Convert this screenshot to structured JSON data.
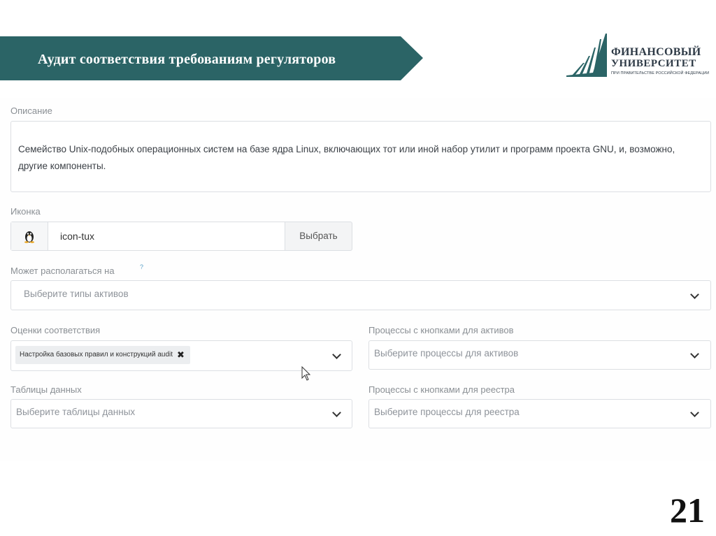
{
  "header": {
    "title": "Аудит соответствия требованиям регуляторов"
  },
  "logo": {
    "line1": "ФИНАНСОВЫЙ",
    "line2": "УНИВЕРСИТЕТ",
    "line3": "ПРИ ПРАВИТЕЛЬСТВЕ РОССИЙСКОЙ ФЕДЕРАЦИИ"
  },
  "form": {
    "description": {
      "label": "Описание",
      "value": "Семейство Unix-подобных операционных систем на базе ядра Linux, включающих тот или иной набор утилит и программ проекта GNU, и, возможно, другие компоненты."
    },
    "icon": {
      "label": "Иконка",
      "value": "icon-tux",
      "icon_name": "tux-icon",
      "choose_button": "Выбрать"
    },
    "location": {
      "label": "Может располагаться на",
      "help": "?",
      "placeholder": "Выберите типы активов"
    },
    "assessments": {
      "label": "Оценки соответствия",
      "tags": [
        "Настройка базовых правил и конструкций audit"
      ]
    },
    "asset_processes": {
      "label": "Процессы с кнопками для активов",
      "placeholder": "Выберите процессы для активов"
    },
    "data_tables": {
      "label": "Таблицы данных",
      "placeholder": "Выберите таблицы данных"
    },
    "registry_processes": {
      "label": "Процессы с кнопками для реестра",
      "placeholder": "Выберите процессы для реестра"
    }
  },
  "page_number": "21",
  "colors": {
    "banner": "#2b6466",
    "border": "#dcdfe3",
    "label": "#8a8f94"
  }
}
